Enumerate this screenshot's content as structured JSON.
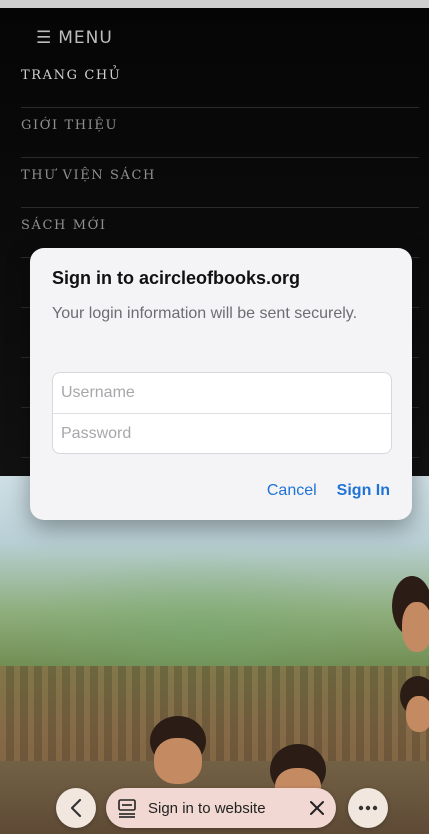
{
  "menu": {
    "toggle_icon": "hamburger-icon",
    "toggle_label": "MENU",
    "items": [
      {
        "label": "TRANG CHỦ"
      },
      {
        "label": "GIỚI THIỆU"
      },
      {
        "label": "THƯ VIỆN SÁCH"
      },
      {
        "label": "SÁCH MỚI"
      }
    ]
  },
  "dialog": {
    "title": "Sign in to acircleofbooks.org",
    "message": "Your login information will be sent securely.",
    "username_placeholder": "Username",
    "password_placeholder": "Password",
    "cancel_label": "Cancel",
    "signin_label": "Sign In"
  },
  "bottom_bar": {
    "back_icon": "chevron-left-icon",
    "pill_icon": "keyboard-icon",
    "pill_label": "Sign in to website",
    "close_icon": "close-icon",
    "more_icon": "more-icon"
  },
  "colors": {
    "accent": "#1f73d6",
    "nav_background": "#0c0c0c",
    "dialog_background": "#f4f4f6"
  }
}
